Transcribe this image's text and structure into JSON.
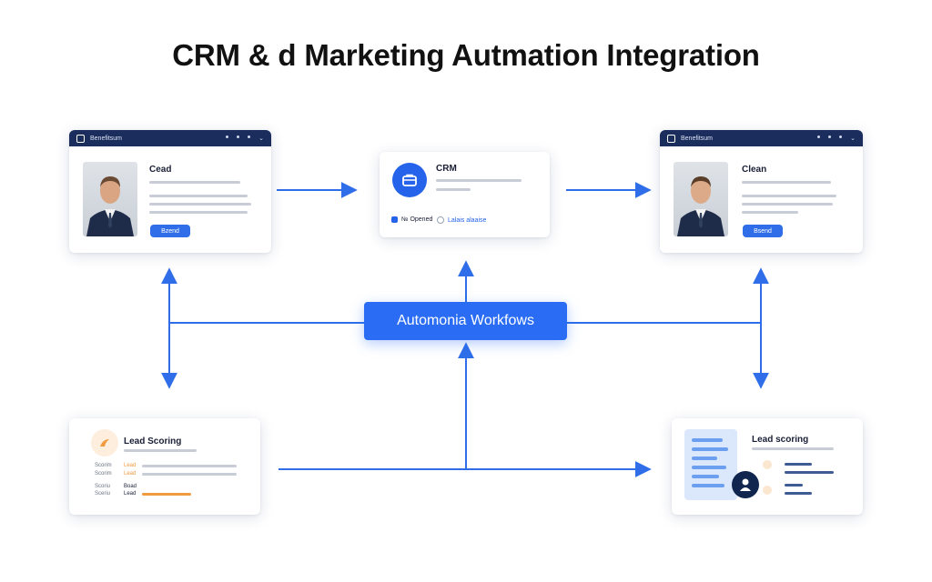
{
  "page": {
    "title": "CRM & d Marketing Autmation Integration"
  },
  "colors": {
    "accent": "#2a6df4",
    "navy": "#1b2d5c",
    "connector": "#2f6ee8",
    "orange": "#f09a3e"
  },
  "cards": {
    "top_left": {
      "bar_text": "Benefitsum",
      "heading": "Cead",
      "button_label": "Bzend",
      "photo_icon": "person-photo"
    },
    "crm": {
      "heading": "CRM",
      "status_label": "№ Opened",
      "link_label": "Lalais alaaise",
      "icon": "briefcase-icon"
    },
    "top_right": {
      "bar_text": "Benefitsum",
      "heading": "Clean",
      "button_label": "Bsend",
      "photo_icon": "person-photo"
    },
    "automation": {
      "label": "Automonia Workfows"
    },
    "lead_scoring_left": {
      "heading": "Lead Scoring",
      "row_labels": [
        "Scorim",
        "Scorim",
        "Scoriu",
        "Sceriu"
      ],
      "row_values": [
        "Lead",
        "Lead",
        "Boad",
        "Lead"
      ],
      "icon": "flame-icon"
    },
    "lead_scoring_right": {
      "heading": "Lead scoring",
      "icon": "person-icon"
    }
  }
}
